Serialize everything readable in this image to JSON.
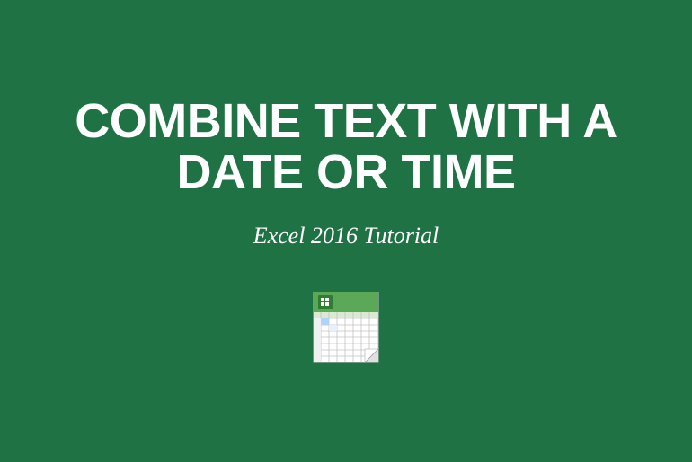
{
  "title": "COMBINE TEXT WITH A DATE OR TIME",
  "subtitle": "Excel 2016 Tutorial",
  "icon_name": "excel-spreadsheet-icon"
}
